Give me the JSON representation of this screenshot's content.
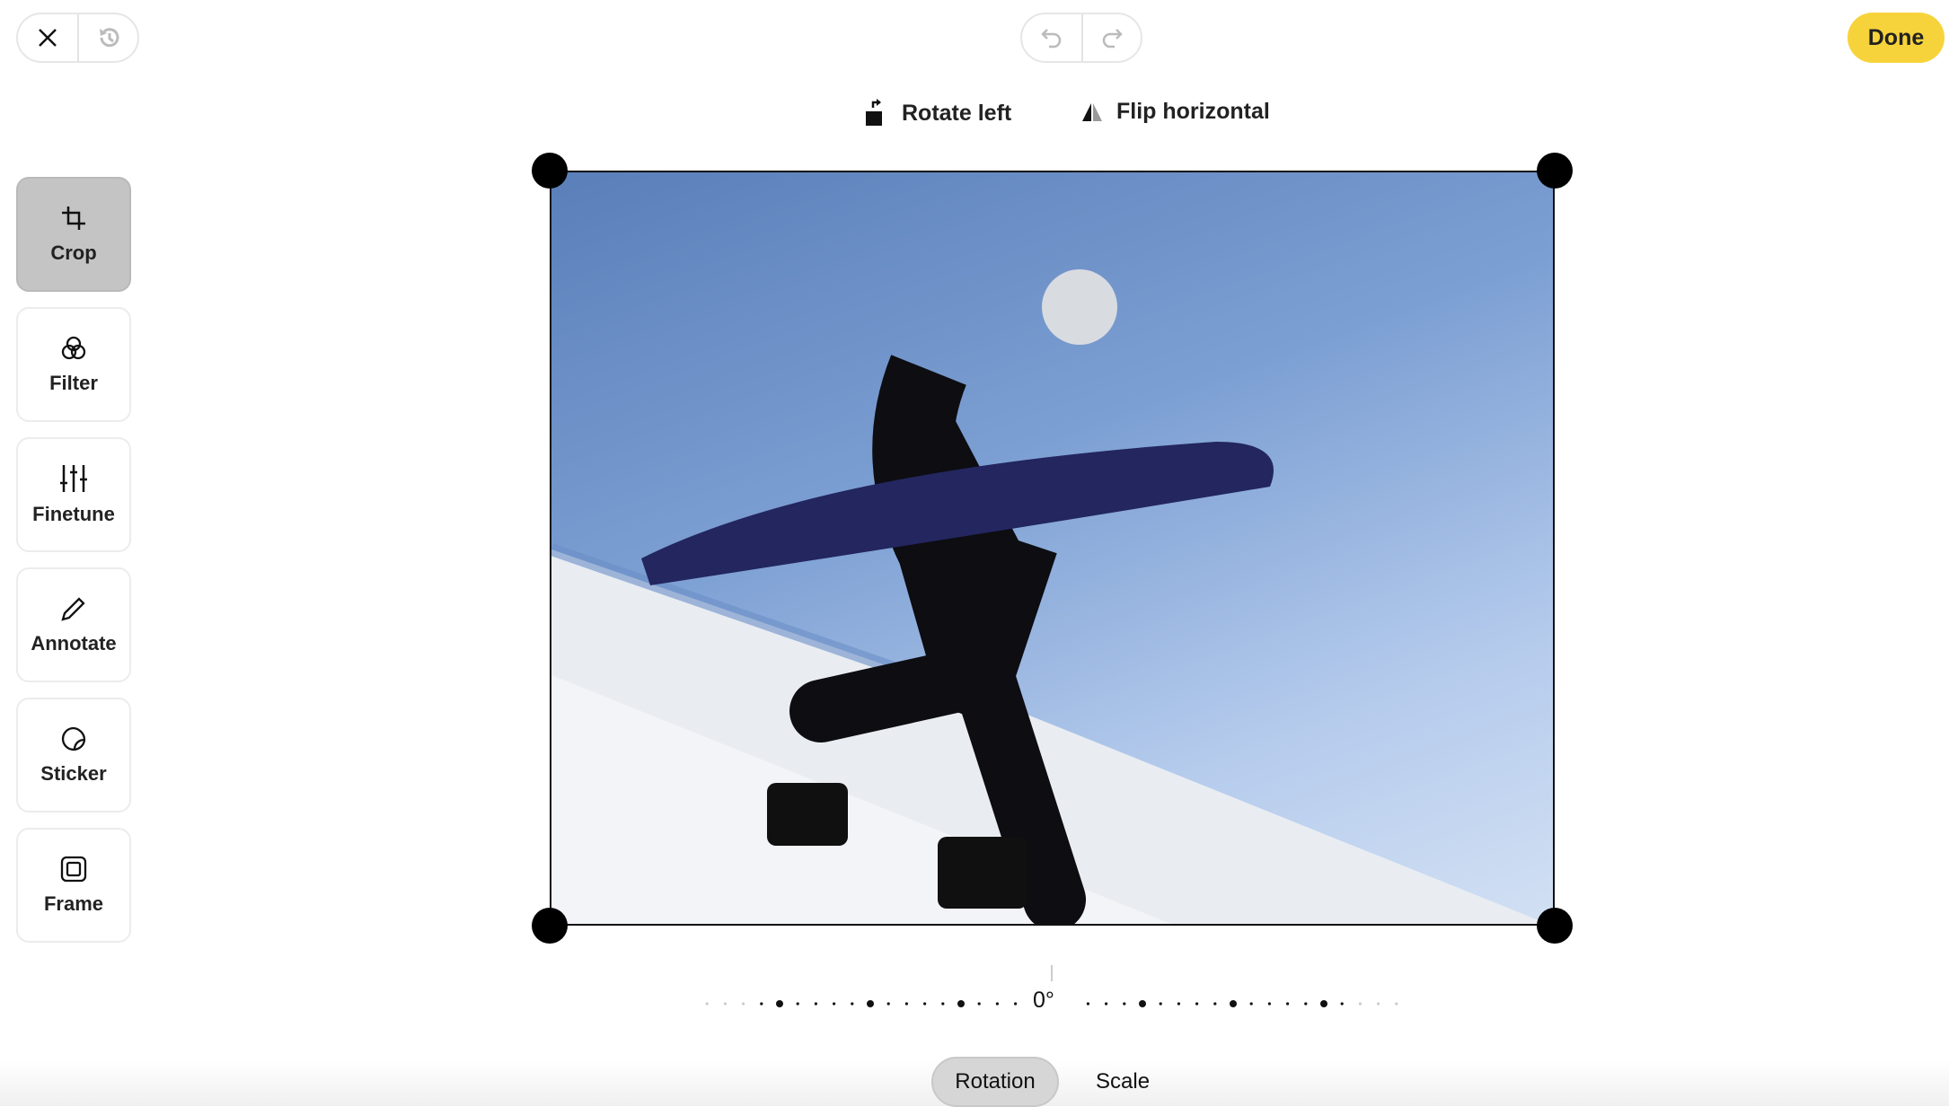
{
  "header": {
    "close_icon": "close-icon",
    "history_icon": "history-icon",
    "undo_icon": "undo-icon",
    "redo_icon": "redo-icon",
    "done_label": "Done",
    "done_color": "#f7d33b"
  },
  "actions": {
    "rotate_left": "Rotate left",
    "flip_horizontal": "Flip horizontal"
  },
  "tools": [
    {
      "label": "Crop",
      "icon": "crop-icon",
      "active": true
    },
    {
      "label": "Filter",
      "icon": "filter-icon"
    },
    {
      "label": "Finetune",
      "icon": "sliders-icon"
    },
    {
      "label": "Annotate",
      "icon": "pencil-icon"
    },
    {
      "label": "Sticker",
      "icon": "sticker-icon"
    },
    {
      "label": "Frame",
      "icon": "frame-icon"
    }
  ],
  "rotation": {
    "value_label": "0°",
    "value": 0
  },
  "tabs": {
    "rotation": "Rotation",
    "scale": "Scale",
    "active": "Rotation"
  }
}
